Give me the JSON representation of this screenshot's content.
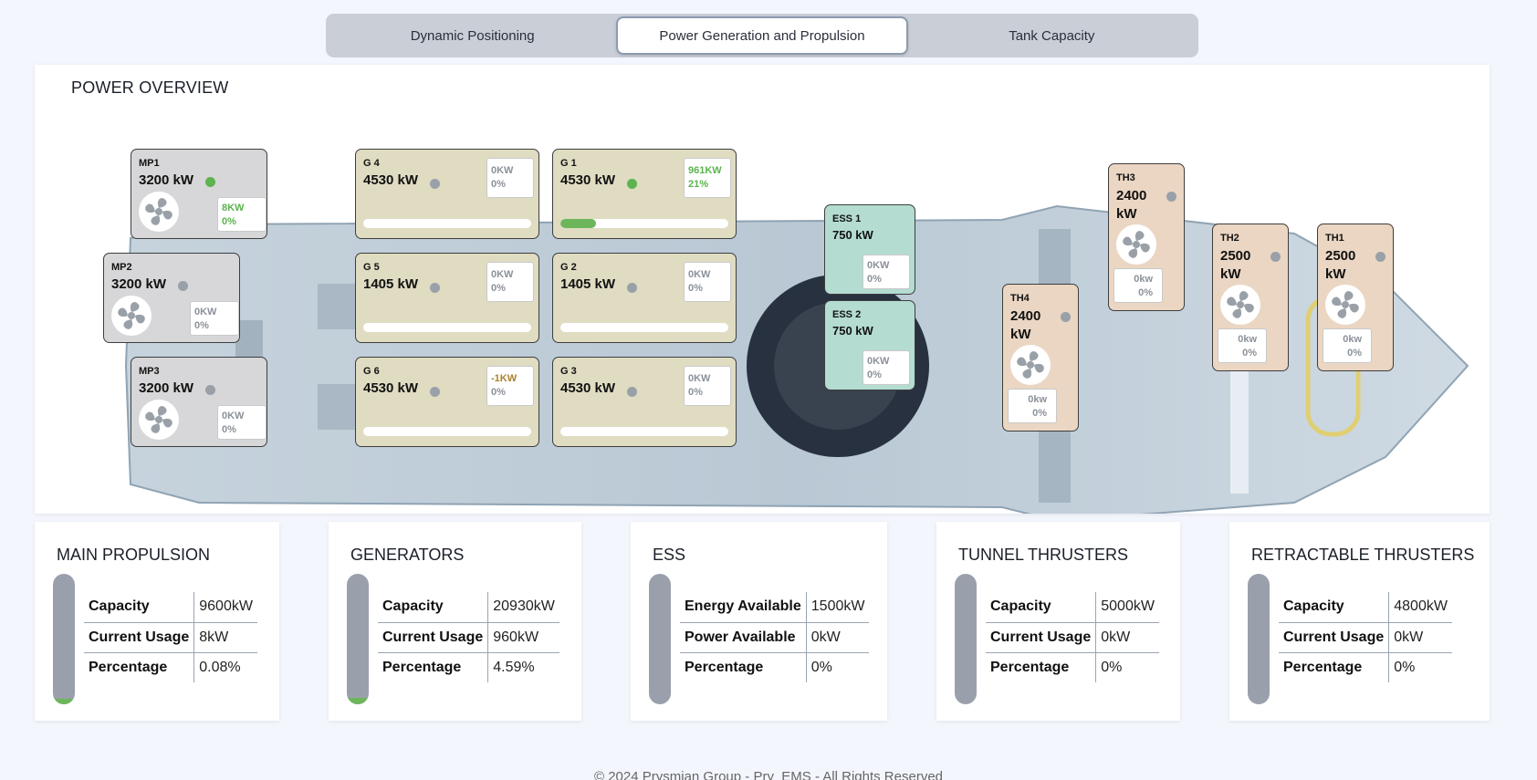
{
  "tabs": [
    {
      "label": "Dynamic Positioning",
      "active": false
    },
    {
      "label": "Power Generation and Propulsion",
      "active": true
    },
    {
      "label": "Tank Capacity",
      "active": false
    }
  ],
  "overview": {
    "title": "POWER OVERVIEW",
    "main_propulsion": [
      {
        "name": "MP1",
        "rating": "3200 kW",
        "status": "on",
        "power": "8KW",
        "percent": "0%"
      },
      {
        "name": "MP2",
        "rating": "3200 kW",
        "status": "off",
        "power": "0KW",
        "percent": "0%"
      },
      {
        "name": "MP3",
        "rating": "3200 kW",
        "status": "off",
        "power": "0KW",
        "percent": "0%"
      }
    ],
    "generators": [
      {
        "name": "G 4",
        "rating": "4530 kW",
        "status": "off",
        "power": "0KW",
        "percent": "0%",
        "load_fraction": 0
      },
      {
        "name": "G 1",
        "rating": "4530 kW",
        "status": "on",
        "power": "961KW",
        "percent": "21%",
        "load_fraction": 0.21
      },
      {
        "name": "G 5",
        "rating": "1405 kW",
        "status": "off",
        "power": "0KW",
        "percent": "0%",
        "load_fraction": 0
      },
      {
        "name": "G 2",
        "rating": "1405 kW",
        "status": "off",
        "power": "0KW",
        "percent": "0%",
        "load_fraction": 0
      },
      {
        "name": "G 6",
        "rating": "4530 kW",
        "status": "off",
        "power": "-1KW",
        "percent": "0%",
        "load_fraction": 0
      },
      {
        "name": "G 3",
        "rating": "4530 kW",
        "status": "off",
        "power": "0KW",
        "percent": "0%",
        "load_fraction": 0
      }
    ],
    "ess": [
      {
        "name": "ESS 1",
        "rating": "750 kW",
        "power": "0KW",
        "percent": "0%"
      },
      {
        "name": "ESS 2",
        "rating": "750 kW",
        "power": "0KW",
        "percent": "0%"
      }
    ],
    "thrusters": [
      {
        "name": "TH3",
        "rating": "2400 kW",
        "status": "off",
        "power": "0kw",
        "percent": "0%"
      },
      {
        "name": "TH4",
        "rating": "2400 kW",
        "status": "off",
        "power": "0kw",
        "percent": "0%"
      },
      {
        "name": "TH2",
        "rating": "2500 kW",
        "status": "off",
        "power": "0kw",
        "percent": "0%"
      },
      {
        "name": "TH1",
        "rating": "2500 kW",
        "status": "off",
        "power": "0kw",
        "percent": "0%"
      }
    ]
  },
  "summaries": [
    {
      "title": "MAIN PROPULSION",
      "level": 0.0008,
      "rows": [
        [
          "Capacity",
          "9600kW"
        ],
        [
          "Current Usage",
          "8kW"
        ],
        [
          "Percentage",
          "0.08%"
        ]
      ]
    },
    {
      "title": "GENERATORS",
      "level": 0.0459,
      "rows": [
        [
          "Capacity",
          "20930kW"
        ],
        [
          "Current Usage",
          "960kW"
        ],
        [
          "Percentage",
          "4.59%"
        ]
      ]
    },
    {
      "title": "ESS",
      "level": 0,
      "rows": [
        [
          "Energy Available",
          "1500kW"
        ],
        [
          "Power Available",
          "0kW"
        ],
        [
          "Percentage",
          "0%"
        ]
      ]
    },
    {
      "title": "TUNNEL THRUSTERS",
      "level": 0,
      "rows": [
        [
          "Capacity",
          "5000kW"
        ],
        [
          "Current Usage",
          "0kW"
        ],
        [
          "Percentage",
          "0%"
        ]
      ]
    },
    {
      "title": "RETRACTABLE THRUSTERS",
      "level": 0,
      "rows": [
        [
          "Capacity",
          "4800kW"
        ],
        [
          "Current Usage",
          "0kW"
        ],
        [
          "Percentage",
          "0%"
        ]
      ]
    }
  ],
  "footer": "© 2024 Prysmian Group - Pry_EMS - All Rights Reserved",
  "colors": {
    "on": "#5cb34f",
    "off": "#9aa0a8",
    "gauge": "#9aa0ab",
    "fill": "#6db65b"
  }
}
